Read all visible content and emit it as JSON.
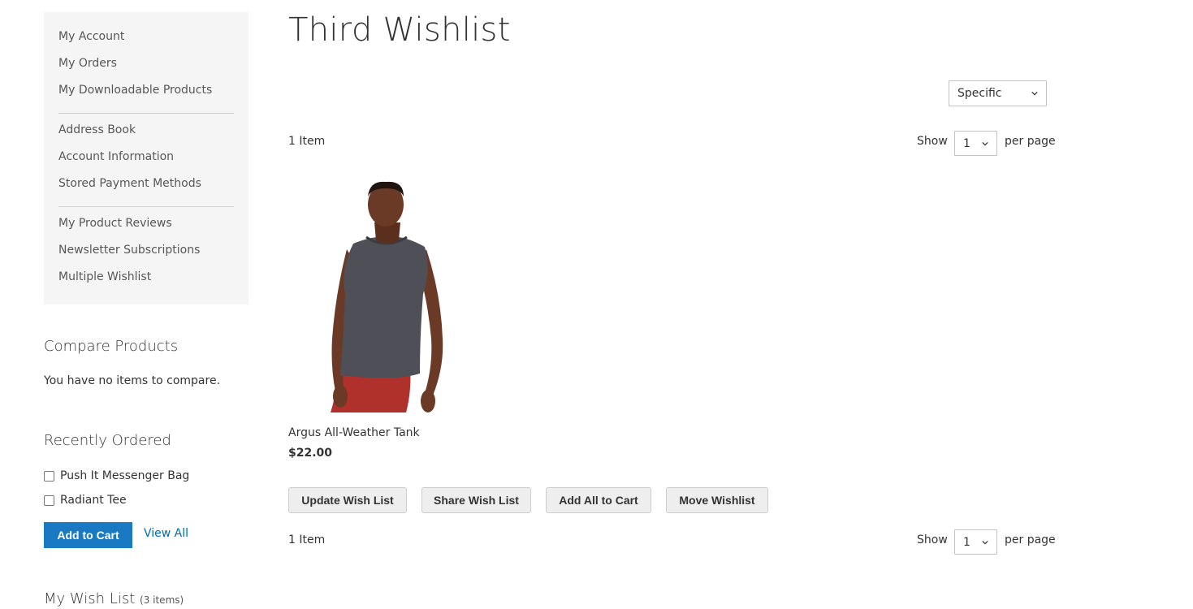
{
  "sidebar": {
    "groups": [
      [
        "My Account",
        "My Orders",
        "My Downloadable Products"
      ],
      [
        "Address Book",
        "Account Information",
        "Stored Payment Methods"
      ],
      [
        "My Product Reviews",
        "Newsletter Subscriptions",
        "Multiple Wishlist"
      ]
    ]
  },
  "compare": {
    "title": "Compare Products",
    "empty_text": "You have no items to compare."
  },
  "recently_ordered": {
    "title": "Recently Ordered",
    "items": [
      "Push It Messenger Bag",
      "Radiant Tee"
    ],
    "add_to_cart_label": "Add to Cart",
    "view_all_label": "View All"
  },
  "my_wishlist": {
    "title": "My Wish List",
    "count": "(3 items)"
  },
  "main": {
    "title": "Third Wishlist",
    "wishlist_select": "Specific",
    "toolbar": {
      "item_count": "1 Item",
      "show_label": "Show",
      "per_page_value": "1",
      "per_page_label": "per page"
    },
    "product": {
      "name": "Argus All-Weather Tank",
      "price": "$22.00",
      "image": "product-photo-man-in-gray-tank-and-red-shorts"
    },
    "buttons": {
      "update": "Update Wish List",
      "share": "Share Wish List",
      "add_all": "Add All to Cart",
      "move": "Move Wishlist"
    }
  },
  "colors": {
    "primary_button": "#1979c3",
    "link": "#006bb4",
    "sidebar_bg": "#f5f5f5"
  }
}
